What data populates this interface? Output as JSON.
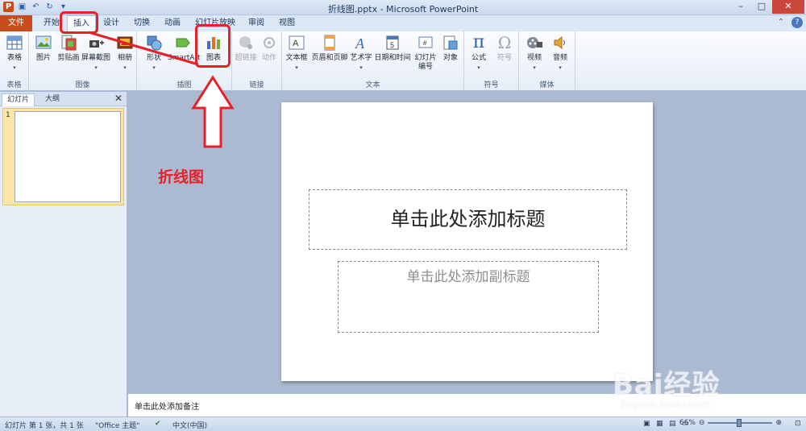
{
  "window": {
    "title": "折线图.pptx - Microsoft PowerPoint"
  },
  "tabs": [
    {
      "label": "文件"
    },
    {
      "label": "开始"
    },
    {
      "label": "插入"
    },
    {
      "label": "设计"
    },
    {
      "label": "切换"
    },
    {
      "label": "动画"
    },
    {
      "label": "幻灯片放映"
    },
    {
      "label": "审阅"
    },
    {
      "label": "视图"
    }
  ],
  "ribbon": {
    "groups": {
      "tables": "表格",
      "images": "图像",
      "illustrations": "插图",
      "links": "链接",
      "text": "文本",
      "symbols": "符号",
      "media": "媒体"
    },
    "buttons": {
      "table": "表格",
      "picture": "图片",
      "clipart": "剪贴画",
      "screenshot": "屏幕截图",
      "album": "相册",
      "shapes": "形状",
      "smartart": "SmartArt",
      "chart": "图表",
      "hyperlink": "超链接",
      "action": "动作",
      "textbox": "文本框",
      "header_footer": "页眉和页脚",
      "wordart": "艺术字",
      "datetime": "日期和时间",
      "slide_number": "幻灯片编号",
      "object": "对象",
      "equation": "公式",
      "symbol": "符号",
      "video": "视频",
      "audio": "音频"
    }
  },
  "panel": {
    "tab_slides": "幻灯片",
    "tab_outline": "大纲",
    "thumb_number": "1"
  },
  "slide": {
    "title_placeholder": "单击此处添加标题",
    "subtitle_placeholder": "单击此处添加副标题"
  },
  "notes": {
    "placeholder": "单击此处添加备注"
  },
  "status": {
    "slide_info": "幻灯片 第 1 张，共 1 张",
    "theme": "\"Office 主题\"",
    "language": "中文(中国)",
    "zoom": "66%"
  },
  "annotation": {
    "text": "折线图"
  },
  "watermark": {
    "brand": "Bai经验",
    "url": "jingyan.baidu.com"
  },
  "colors": {
    "annotation_red": "#e8202a",
    "file_tab": "#c94b1c",
    "ribbon_bg": "#fbfcfe"
  }
}
